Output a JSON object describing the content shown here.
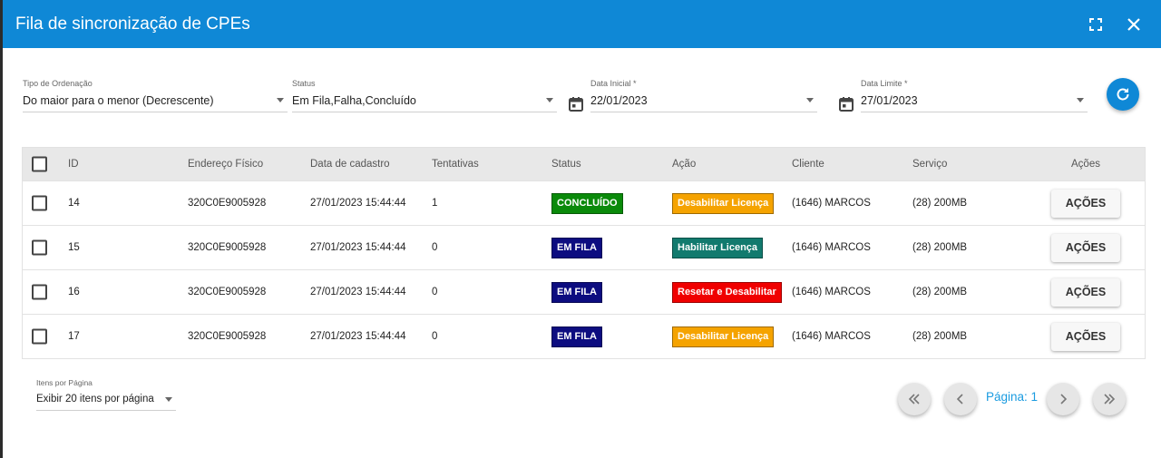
{
  "dialog": {
    "title": "Fila de sincronização de CPEs"
  },
  "filters": {
    "ordering": {
      "label": "Tipo de Ordenação",
      "value": "Do maior para o menor (Decrescente)"
    },
    "status": {
      "label": "Status",
      "value": "Em Fila,Falha,Concluído"
    },
    "start_date": {
      "label": "Data Inicial *",
      "value": "22/01/2023"
    },
    "end_date": {
      "label": "Data Limite *",
      "value": "27/01/2023"
    }
  },
  "table": {
    "headers": [
      "ID",
      "Endereço Físico",
      "Data de cadastro",
      "Tentativas",
      "Status",
      "Ação",
      "Cliente",
      "Serviço",
      "Ações"
    ],
    "rows": [
      {
        "id": "14",
        "mac": "320C0E9005928",
        "date": "27/01/2023 15:44:44",
        "attempts": "1",
        "status": "CONCLUÍDO",
        "action": "Desabilitar Licença",
        "client": "(1646) MARCOS",
        "service": "(28) 200MB",
        "actions_label": "AÇÕES"
      },
      {
        "id": "15",
        "mac": "320C0E9005928",
        "date": "27/01/2023 15:44:44",
        "attempts": "0",
        "status": "EM FILA",
        "action": "Habilitar Licença",
        "client": "(1646) MARCOS",
        "service": "(28) 200MB",
        "actions_label": "AÇÕES"
      },
      {
        "id": "16",
        "mac": "320C0E9005928",
        "date": "27/01/2023 15:44:44",
        "attempts": "0",
        "status": "EM FILA",
        "action": "Resetar e Desabilitar",
        "client": "(1646) MARCOS",
        "service": "(28) 200MB",
        "actions_label": "AÇÕES"
      },
      {
        "id": "17",
        "mac": "320C0E9005928",
        "date": "27/01/2023 15:44:44",
        "attempts": "0",
        "status": "EM FILA",
        "action": "Desabilitar Licença",
        "client": "(1646) MARCOS",
        "service": "(28) 200MB",
        "actions_label": "AÇÕES"
      }
    ]
  },
  "pagination": {
    "per_page_label": "Itens por Página",
    "per_page_value": "Exibir 20 itens por página",
    "page_label": "Página: 1"
  },
  "colors": {
    "header_blue": "#0f88d6",
    "status_done": "#0a8a0a",
    "status_queued": "#0d0d80",
    "action_disable": "#f5a300",
    "action_enable": "#127a6e",
    "action_reset": "#f00000"
  },
  "icons": {
    "maximize": "fullscreen-icon",
    "close": "close-icon",
    "calendar": "calendar-icon",
    "refresh": "refresh-icon",
    "first": "double-chevron-left-icon",
    "prev": "chevron-left-icon",
    "next": "chevron-right-icon",
    "last": "double-chevron-right-icon"
  }
}
